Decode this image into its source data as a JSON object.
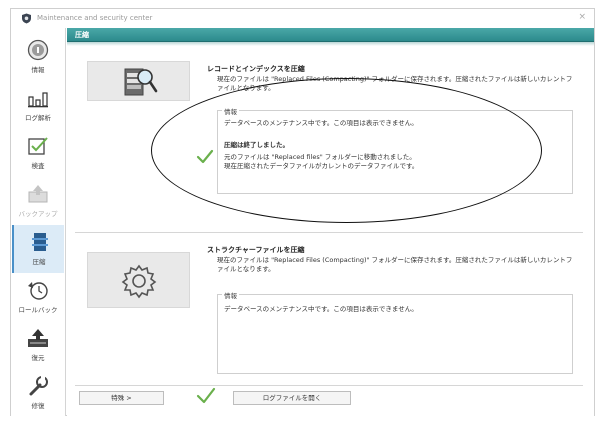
{
  "window": {
    "title": "Maintenance and security center",
    "close_glyph": "×"
  },
  "sidebar": {
    "items": [
      {
        "label": "情報",
        "icon": "info-icon",
        "state": "normal"
      },
      {
        "label": "ログ解析",
        "icon": "log-analysis-icon",
        "state": "normal"
      },
      {
        "label": "検査",
        "icon": "inspection-icon",
        "state": "normal"
      },
      {
        "label": "バックアップ",
        "icon": "backup-icon",
        "state": "disabled"
      },
      {
        "label": "圧縮",
        "icon": "compress-icon",
        "state": "active"
      },
      {
        "label": "ロールバック",
        "icon": "rollback-icon",
        "state": "normal"
      },
      {
        "label": "復元",
        "icon": "restore-icon",
        "state": "normal"
      },
      {
        "label": "修復",
        "icon": "repair-icon",
        "state": "normal"
      }
    ]
  },
  "header": {
    "title": "圧縮"
  },
  "compress_records": {
    "title": "レコードとインデックスを圧縮",
    "description": "現在のファイルは \"Replaced Files (Compacting)\" フォルダーに保存されます。圧縮されたファイルは新しいカレントファイルとなります。",
    "info_label": "情報",
    "info_message": "データベースのメンテナンス中です。この項目は表示できません。",
    "done_title": "圧縮は終了しました。",
    "done_line1": "元のファイルは \"Replaced files\" フォルダーに移動されました。",
    "done_line2": "現在圧縮されたデータファイルがカレントのデータファイルです。",
    "icon": "database-search-icon",
    "check_icon": "checkmark-icon"
  },
  "compress_structure": {
    "title": "ストラクチャーファイルを圧縮",
    "description": "現在のファイルは \"Replaced Files (Compacting)\" フォルダーに保存されます。圧縮されたファイルは新しいカレントファイルとなります。",
    "info_label": "情報",
    "info_message": "データベースのメンテナンス中です。この項目は表示できません。",
    "icon": "gear-icon"
  },
  "footer": {
    "special_button": "特殊 >",
    "open_log_button": "ログファイルを開く",
    "check_icon": "checkmark-icon"
  },
  "colors": {
    "header": "#2c8a8c",
    "accent": "#4a90c8",
    "check": "#6ab04c"
  }
}
